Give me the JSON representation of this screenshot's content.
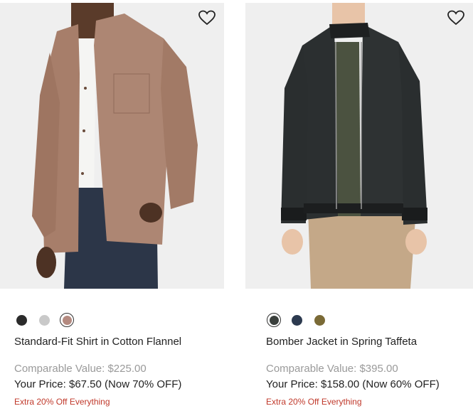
{
  "products": [
    {
      "name": "Standard-Fit Shirt in Cotton Flannel",
      "comparable_value": "Comparable Value: $225.00",
      "your_price": "Your Price: $67.50 (Now 70% OFF)",
      "promo": "Extra 20% Off Everything",
      "swatches": [
        {
          "color": "#2b2b2b",
          "selected": false
        },
        {
          "color": "#c9c9c9",
          "selected": false
        },
        {
          "color": "#b48a80",
          "selected": true
        }
      ],
      "icon": "heart-icon"
    },
    {
      "name": "Bomber Jacket in Spring Taffeta",
      "comparable_value": "Comparable Value: $395.00",
      "your_price": "Your Price: $158.00 (Now 60% OFF)",
      "promo": "Extra 20% Off Everything",
      "swatches": [
        {
          "color": "#3a3f3c",
          "selected": true
        },
        {
          "color": "#2c3a4f",
          "selected": false
        },
        {
          "color": "#7a6a36",
          "selected": false
        }
      ],
      "icon": "heart-icon"
    }
  ],
  "colors": {
    "promo": "#c0392b",
    "comparable": "#9a9a9a",
    "image_bg": "#efefef"
  }
}
